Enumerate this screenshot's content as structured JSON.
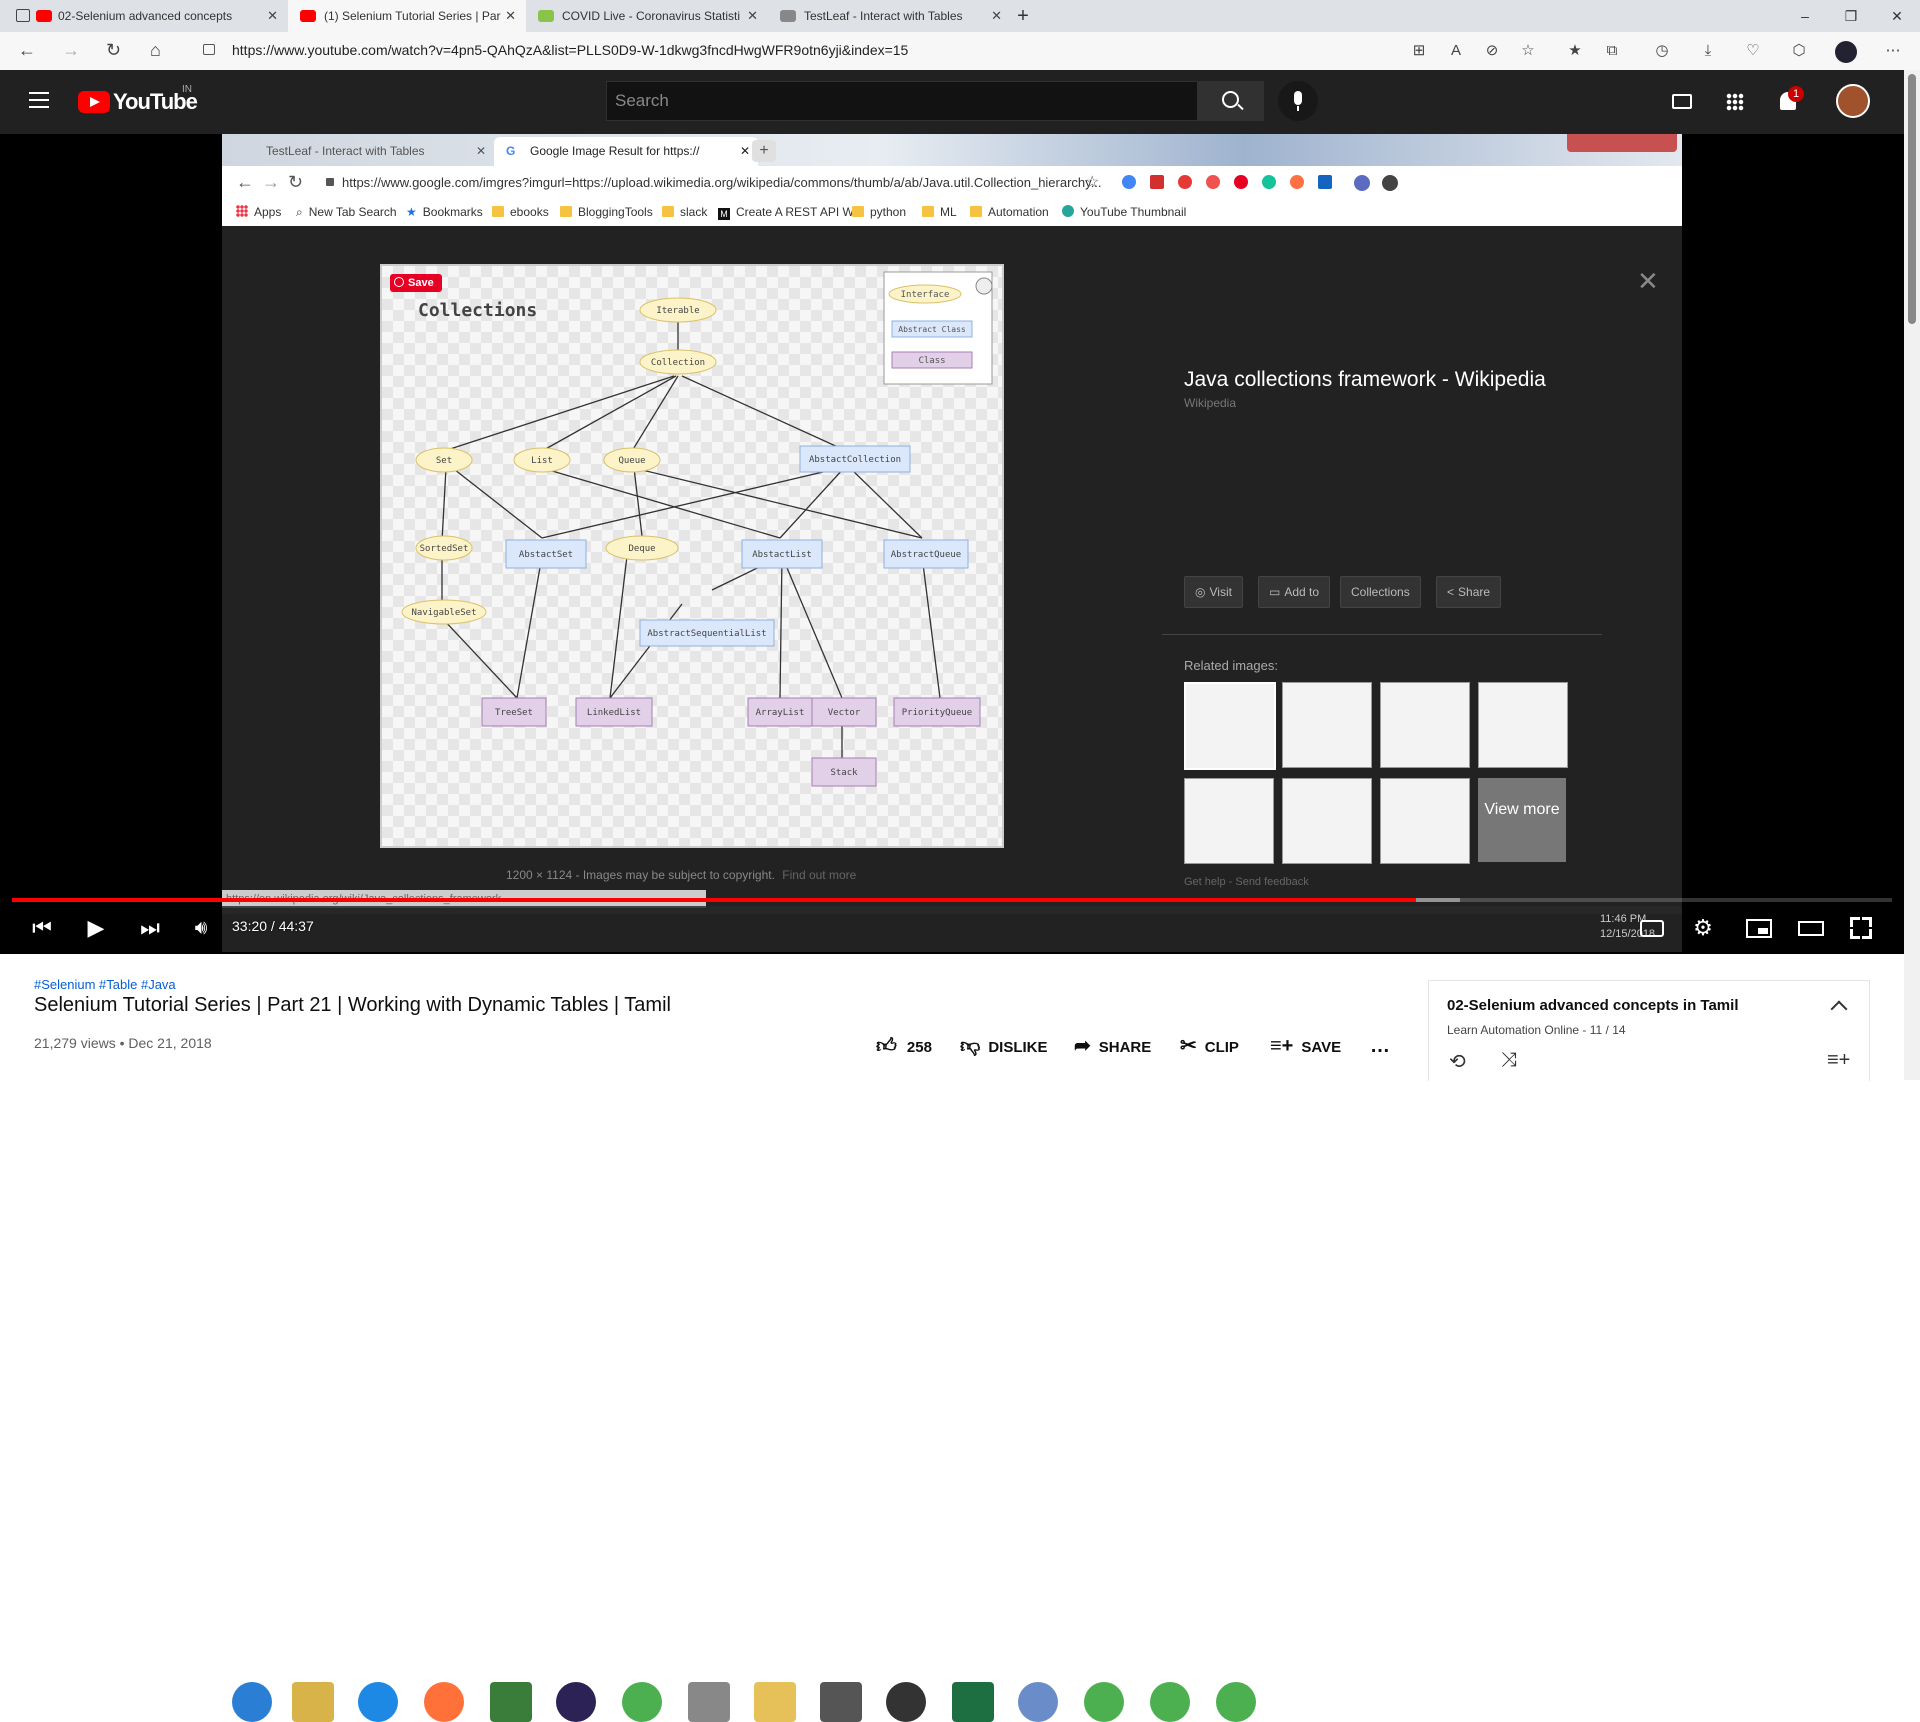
{
  "browser": {
    "tabs": [
      {
        "title": "02-Selenium advanced concepts",
        "color": "#ff0000"
      },
      {
        "title": "(1) Selenium Tutorial Series | Par",
        "color": "#ff0000"
      },
      {
        "title": "COVID Live - Coronavirus Statisti",
        "color": "#8bc34a"
      },
      {
        "title": "TestLeaf - Interact with Tables",
        "color": "#888888"
      }
    ],
    "new_tab": "+",
    "url": "https://www.youtube.com/watch?v=4pn5-QAhQzA&list=PLLS0D9-W-1dkwg3fncdHwgWFR9otn6yji&index=15",
    "win_min": "–",
    "win_max": "❐",
    "win_close": "✕"
  },
  "youtube": {
    "logo_text": "YouTube",
    "region": "IN",
    "search_placeholder": "Search",
    "notif_count": "1"
  },
  "inner_browser": {
    "tabs": [
      "TestLeaf - Interact with Tables",
      "Google Image Result for https://"
    ],
    "url": "https://www.google.com/imgres?imgurl=https://upload.wikimedia.org/wikipedia/commons/thumb/a/ab/Java.util.Collection_hierarchy...",
    "bookmarks": [
      "Apps",
      "New Tab Search",
      "Bookmarks",
      "ebooks",
      "BloggingTools",
      "slack",
      "Create A REST API W",
      "python",
      "ML",
      "Automation",
      "YouTube Thumbnail"
    ],
    "save_btn": "Save",
    "diagram_title": "Collections",
    "legend": [
      "Interface",
      "Abstract Class",
      "Class"
    ],
    "nodes": {
      "iterable": "Iterable",
      "collection": "Collection",
      "set": "Set",
      "list": "List",
      "queue": "Queue",
      "abstract_collection": "AbstactCollection",
      "sorted_set": "SortedSet",
      "abstract_set": "AbstactSet",
      "deque": "Deque",
      "abstract_list": "AbstactList",
      "abstract_queue": "AbstractQueue",
      "navigable_set": "NavigableSet",
      "abstract_seq_list": "AbstractSequentialList",
      "tree_set": "TreeSet",
      "linked_list": "LinkedList",
      "array_list": "ArrayList",
      "vector": "Vector",
      "priority_queue": "PriorityQueue",
      "stack": "Stack"
    },
    "result_title": "Java collections framework - Wikipedia",
    "result_source": "Wikipedia",
    "buttons": [
      "Visit",
      "Add to",
      "Collections",
      "Share"
    ],
    "related_label": "Related images:",
    "view_more": "View more",
    "image_info": "1200 × 1124 - Images may be subject to copyright.",
    "find_out_more": "Find out more",
    "help": "Get help - Send feedback",
    "status_url": "https://en.wikipedia.org/wiki/Java_collections_framework",
    "tray_time": "11:46 PM",
    "tray_date": "12/15/2018"
  },
  "player": {
    "time": "33:20 / 44:37",
    "progress_fraction": 0.7468,
    "buffer_fraction": 0.77
  },
  "video": {
    "hashtags": "#Selenium #Table #Java",
    "title": "Selenium Tutorial Series | Part 21 | Working with Dynamic Tables | Tamil",
    "views": "21,279 views • Dec 21, 2018",
    "likes": "258",
    "dislike": "DISLIKE",
    "share": "SHARE",
    "clip": "CLIP",
    "save": "SAVE",
    "more": "…"
  },
  "playlist": {
    "title": "02-Selenium advanced concepts in Tamil",
    "channel": "Learn Automation Online - 11 / 14"
  }
}
